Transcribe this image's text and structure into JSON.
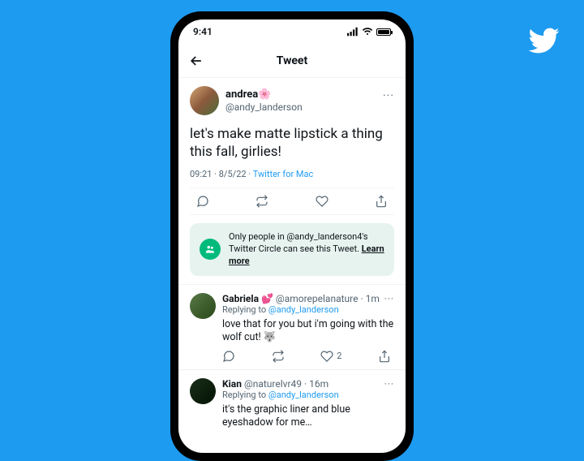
{
  "status_bar": {
    "time": "9:41"
  },
  "header": {
    "title": "Tweet"
  },
  "main_tweet": {
    "display_name": "andrea🌸",
    "handle": "@andy_landerson",
    "text": "let's make matte lipstick a thing this fall, girlies!",
    "time": "09:21",
    "date": "8/5/22",
    "source": "Twitter for Mac"
  },
  "circle_banner": {
    "text": "Only people in @andy_landerson4's Twitter Circle can see this Tweet.",
    "learn_more": "Learn more"
  },
  "replies": [
    {
      "display_name": "Gabriela 💕",
      "handle": "@amorepelanature",
      "time": "1m",
      "replying_to_prefix": "Replying to",
      "replying_to": "@andy_landerson",
      "text": "love that for you but i'm going with the wolf cut! 🐺",
      "like_count": "2"
    },
    {
      "display_name": "Kian",
      "handle": "@naturelvr49",
      "time": "16m",
      "replying_to_prefix": "Replying to",
      "replying_to": "@andy_landerson",
      "text": "it's the graphic liner and blue eyeshadow for me…"
    }
  ]
}
